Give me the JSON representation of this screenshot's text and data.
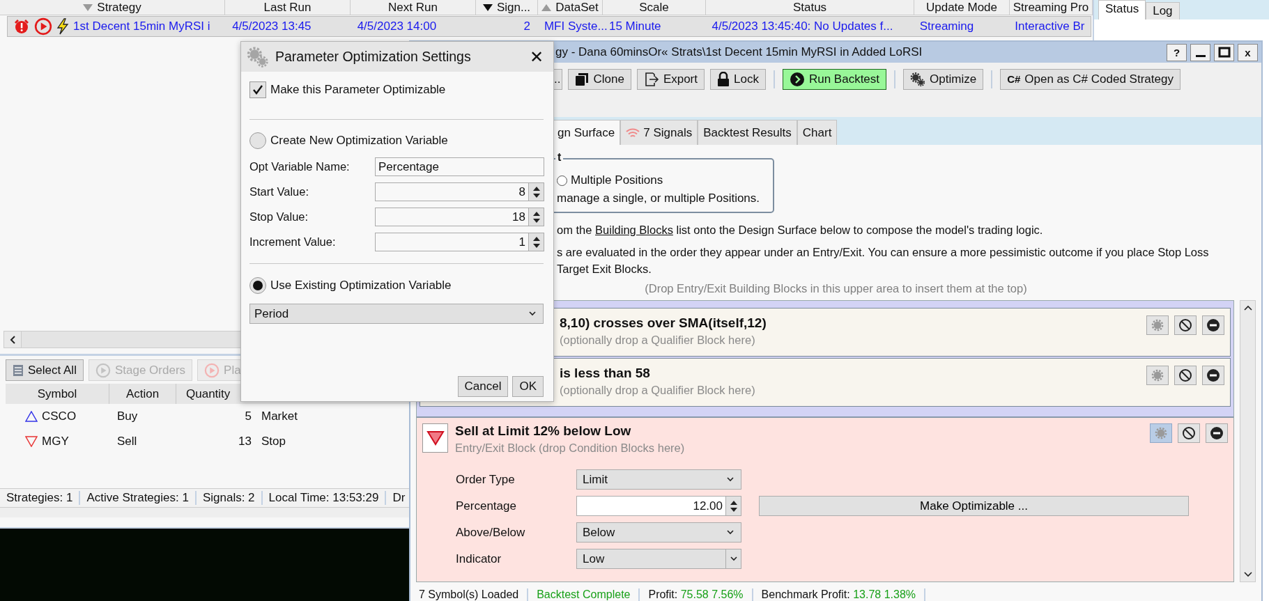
{
  "strategy_table": {
    "columns": [
      {
        "label": "Strategy",
        "sorted": true,
        "descending": true,
        "sort_primary": false
      },
      {
        "label": "Last Run",
        "sorted": false
      },
      {
        "label": "Next Run",
        "sorted": false
      },
      {
        "label": "Sign...",
        "sorted": true,
        "descending": true,
        "sort_primary": true
      },
      {
        "label": "DataSet",
        "sorted": true,
        "descending": false,
        "sort_primary": false
      },
      {
        "label": "Scale",
        "sorted": false
      },
      {
        "label": "Status",
        "sorted": false
      },
      {
        "label": "Update Mode",
        "sorted": false
      },
      {
        "label": "Streaming Pro",
        "sorted": false
      }
    ],
    "rows": [
      {
        "selected": true,
        "cells": [
          "1st Decent 15min MyRSI i",
          "4/5/2023 13:45",
          "4/5/2023 14:00",
          "2",
          "MFI Syste...",
          "15 Minute",
          "4/5/2023 13:45:40: No Updates f...",
          "Streaming",
          "Interactive Br"
        ]
      }
    ]
  },
  "side_panel": {
    "tabs": [
      {
        "label": "Status",
        "selected": true
      },
      {
        "label": "Log",
        "selected": false
      }
    ]
  },
  "orders_toolbar": [
    {
      "label": "Select All",
      "disabled": false,
      "kind": "list"
    },
    {
      "label": "Stage Orders",
      "disabled": true,
      "kind": "stage"
    },
    {
      "label": "Pla",
      "disabled": true,
      "kind": "place"
    }
  ],
  "orders_table": {
    "columns": [
      "Symbol",
      "Action",
      "Quantity"
    ],
    "rows": [
      {
        "kind": "buy",
        "symbol": "CSCO",
        "action": "Buy",
        "quantity": "5",
        "column_4": "Market"
      },
      {
        "kind": "sell",
        "symbol": "MGY",
        "action": "Sell",
        "quantity": "13",
        "column_4": "Stop"
      }
    ]
  },
  "status_bar": [
    "Strategies: 1",
    "Active Strategies: 1",
    "Signals: 2",
    "Local Time: 13:53:29",
    "Dr"
  ],
  "strategy_window": {
    "title": "gy - Dana 60minsOr« Strats\\1st Decent 15min MyRSI in Added LoRSI",
    "help_button": "?",
    "close_button": "x",
    "toolbar": [
      {
        "label": "..",
        "kind": "plain",
        "highlighted": false
      },
      {
        "label": "Clone",
        "kind": "clone",
        "highlighted": false
      },
      {
        "label": "Export",
        "kind": "export",
        "highlighted": false
      },
      {
        "label": "Lock",
        "kind": "lock",
        "highlighted": false
      },
      {
        "label": "Run Backtest",
        "kind": "run",
        "highlighted": true
      },
      {
        "label": "Optimize",
        "kind": "optimize",
        "highlighted": false
      },
      {
        "label": "Open as C# Coded Strategy",
        "kind": "code",
        "badge": "C#",
        "highlighted": false
      }
    ],
    "tabs": [
      {
        "label": "gn Surface",
        "selected": true,
        "kind": "plain"
      },
      {
        "label": "7 Signals",
        "selected": false,
        "kind": "signals"
      },
      {
        "label": "Backtest Results",
        "selected": false,
        "kind": "plain"
      },
      {
        "label": "Chart",
        "selected": false,
        "kind": "plain"
      }
    ],
    "position_group": {
      "heading": "t",
      "option": "Multiple Positions",
      "option_selected": false,
      "description": "manage a single, or multiple Positions."
    },
    "instruction": {
      "before": "om the ",
      "link": "Building Blocks",
      "after": " list onto the Design Surface below to compose the model's trading logic."
    },
    "note": "s are evaluated in the order they appear under an Entry/Exit. You can ensure a more pessimistic outcome if you place Stop Loss Target Exit Blocks.",
    "drop_hint": "(Drop Entry/Exit Building Blocks in this upper area to insert them at the top)",
    "condition_blocks": [
      {
        "title": "8,10) crosses over SMA(itself,12)",
        "hint": "(optionally drop a Qualifier Block here)",
        "settings_active": false
      },
      {
        "title": "is less than 58",
        "hint": "(optionally drop a Qualifier Block here)",
        "settings_active": false
      }
    ],
    "entry_block": {
      "kind": "sell",
      "title": "Sell at Limit 12% below Low",
      "subtitle": "Entry/Exit Block (drop Condition Blocks here)",
      "settings_active": true,
      "params": [
        {
          "label": "Order Type",
          "kind": "select",
          "value": "Limit"
        },
        {
          "label": "Percentage",
          "kind": "spinner",
          "value": "12.00"
        },
        {
          "label": "Above/Below",
          "kind": "select",
          "value": "Below"
        },
        {
          "label": "Indicator",
          "kind": "combo",
          "value": "Low"
        }
      ],
      "optimize_button": "Make Optimizable ..."
    },
    "status_bar": [
      {
        "text": "7 Symbol(s) Loaded",
        "kind": "plain"
      },
      {
        "text": "Backtest Complete",
        "kind": "good"
      },
      {
        "label": "Profit:",
        "text": "75.58 7.56%",
        "kind": "labeled"
      },
      {
        "label": "Benchmark Profit:",
        "text": "13.78 1.38%",
        "kind": "labeled"
      }
    ]
  },
  "dialog": {
    "title": "Parameter Optimization Settings",
    "close_button": "✕",
    "optimizable": {
      "label": "Make this Parameter Optimizable",
      "checked": true
    },
    "new_variable": {
      "label": "Create New Optimization Variable",
      "selected": false,
      "fields": [
        {
          "label": "Opt Variable Name:",
          "kind": "text",
          "value": "Percentage"
        },
        {
          "label": "Start Value:",
          "kind": "spinner",
          "value": "8"
        },
        {
          "label": "Stop Value:",
          "kind": "spinner",
          "value": "18"
        },
        {
          "label": "Increment Value:",
          "kind": "spinner",
          "value": "1"
        }
      ]
    },
    "existing_variable": {
      "label": "Use Existing Optimization Variable",
      "selected": true,
      "value": "Period"
    },
    "buttons": [
      "Cancel",
      "OK"
    ]
  }
}
